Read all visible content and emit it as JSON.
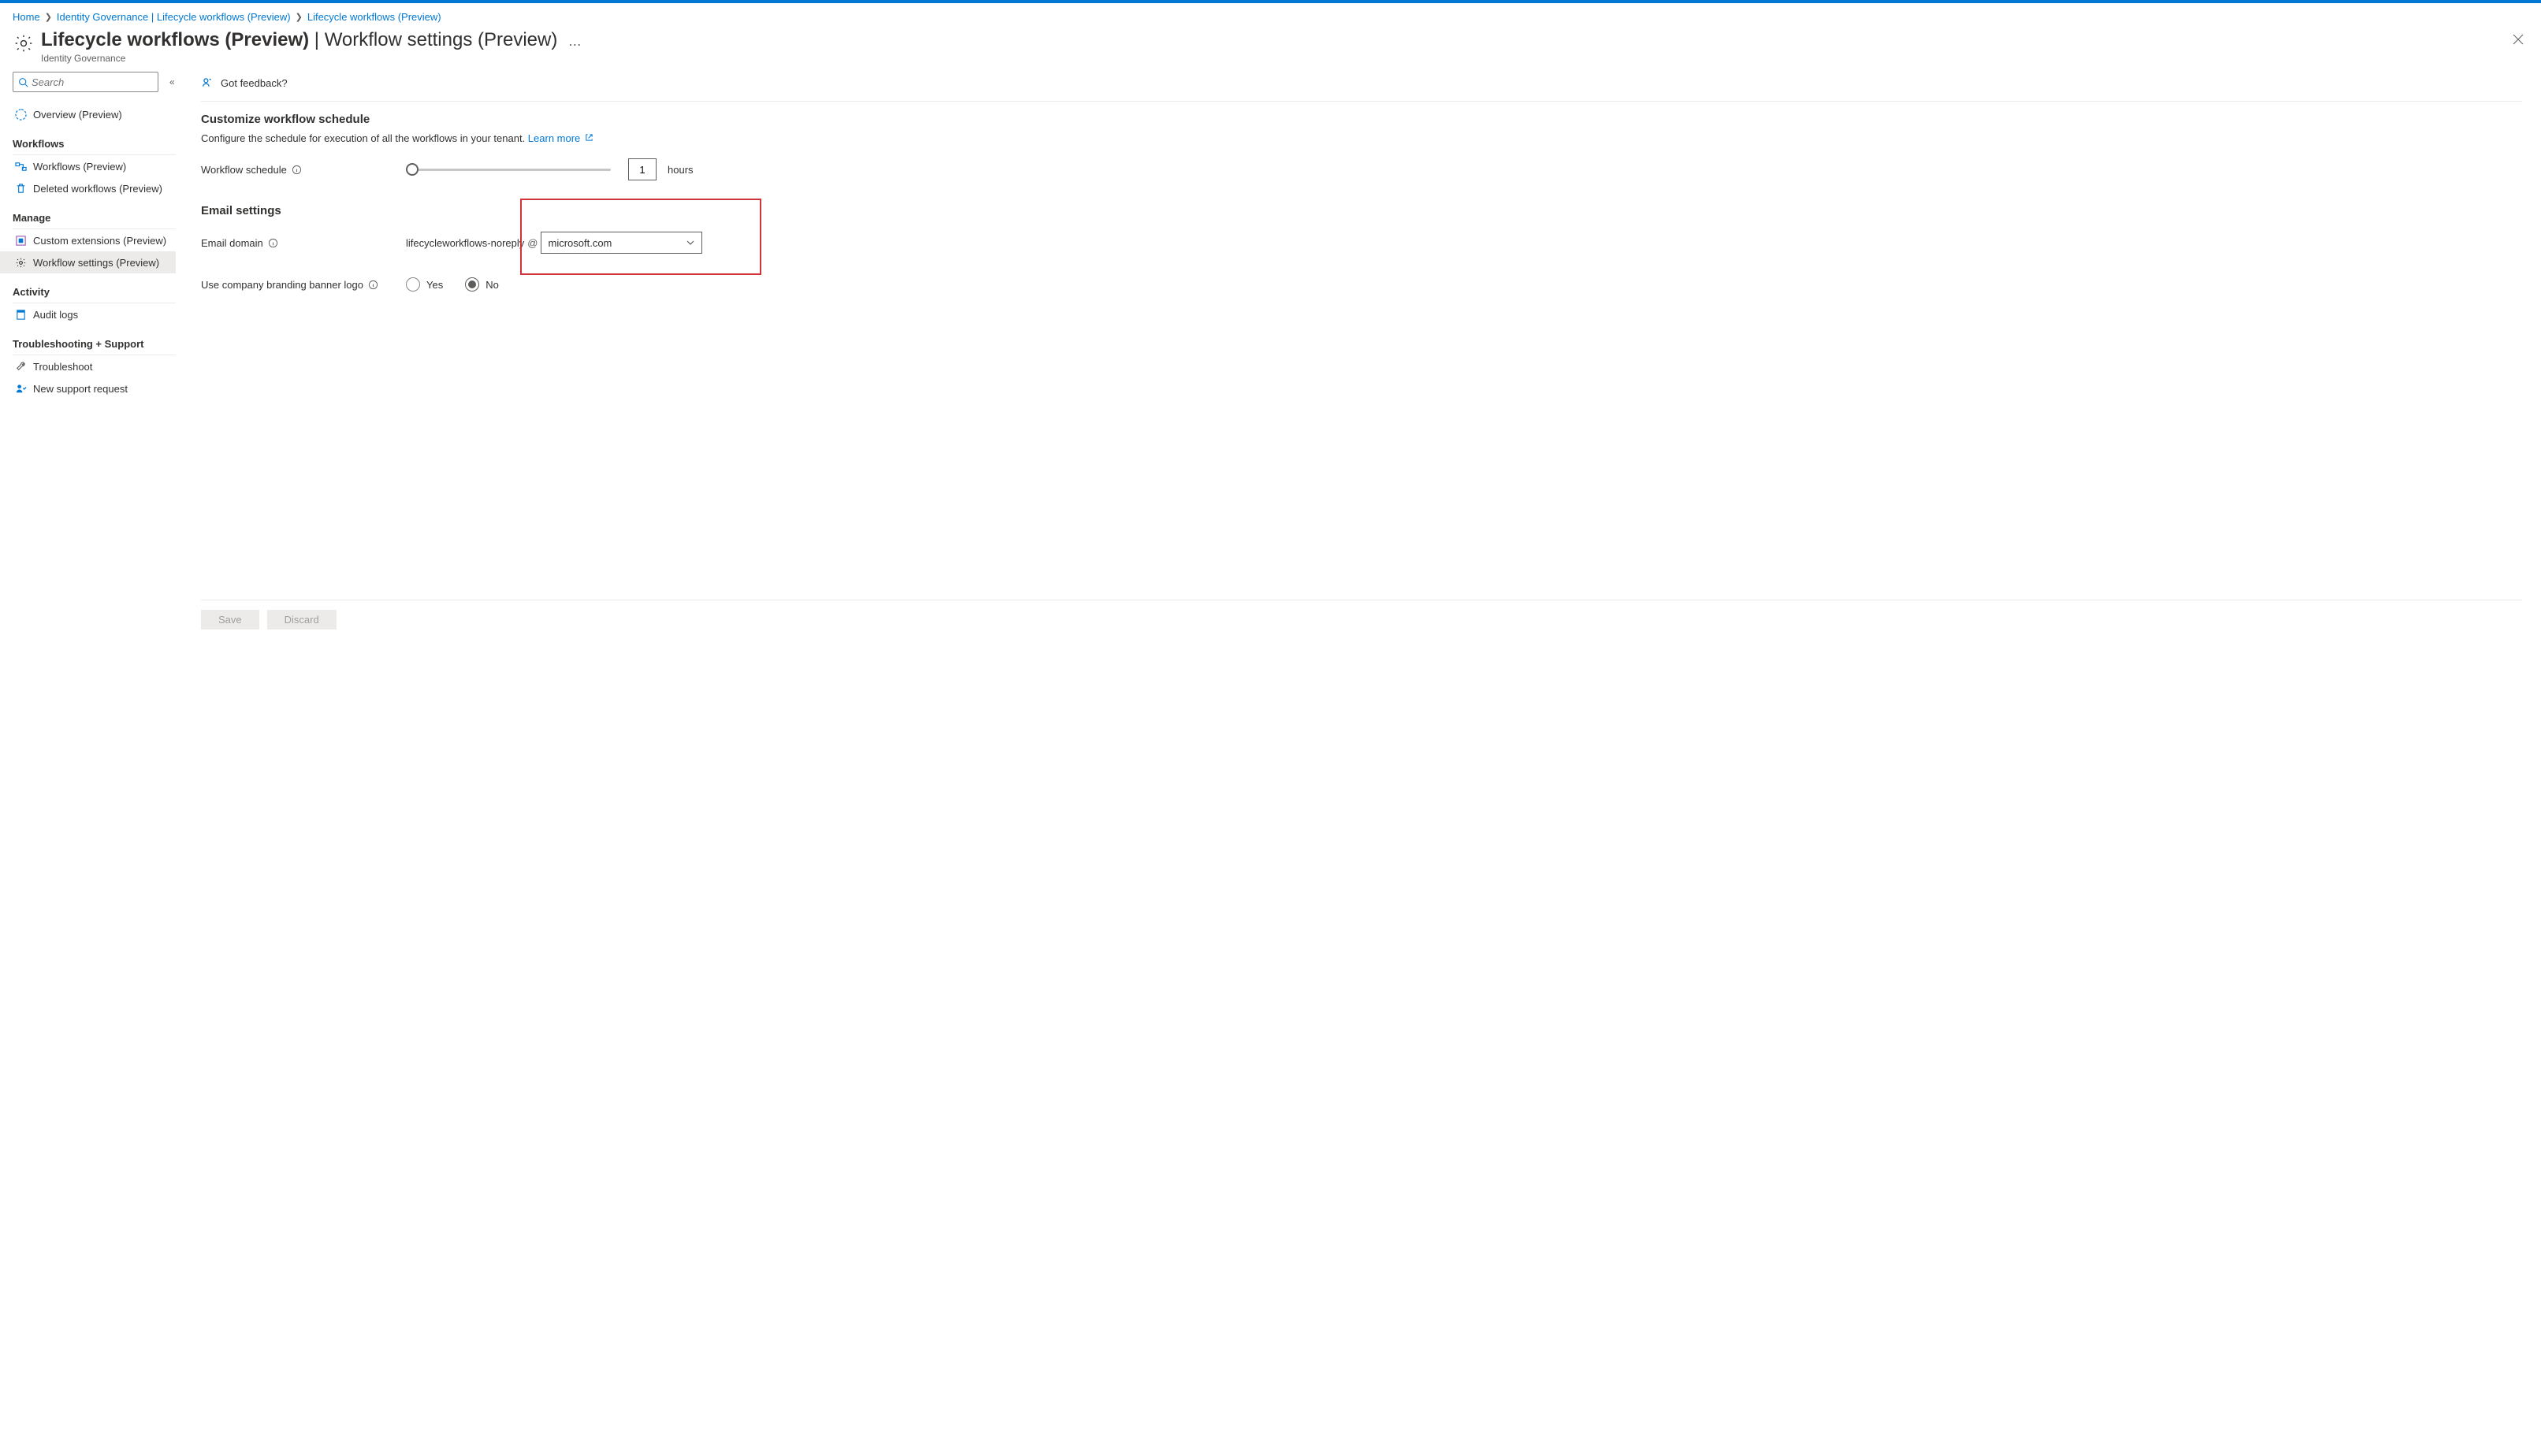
{
  "breadcrumbs": {
    "home": "Home",
    "idgov": "Identity Governance | Lifecycle workflows (Preview)",
    "lcw": "Lifecycle workflows (Preview)"
  },
  "header": {
    "title_strong": "Lifecycle workflows (Preview)",
    "title_sep": " | ",
    "title_light": "Workflow settings (Preview)",
    "subtitle": "Identity Governance"
  },
  "sidebar": {
    "search_placeholder": "Search",
    "items": {
      "overview": "Overview (Preview)",
      "group_workflows": "Workflows",
      "workflows": "Workflows (Preview)",
      "deleted": "Deleted workflows (Preview)",
      "group_manage": "Manage",
      "custom_ext": "Custom extensions (Preview)",
      "wf_settings": "Workflow settings (Preview)",
      "group_activity": "Activity",
      "audit": "Audit logs",
      "group_trouble": "Troubleshooting + Support",
      "troubleshoot": "Troubleshoot",
      "support": "New support request"
    }
  },
  "toolbar": {
    "feedback": "Got feedback?"
  },
  "schedule": {
    "title": "Customize workflow schedule",
    "desc": "Configure the schedule for execution of all the workflows in your tenant. ",
    "learn_more": "Learn more",
    "label": "Workflow schedule",
    "value": "1",
    "unit": "hours"
  },
  "email": {
    "title": "Email settings",
    "domain_label": "Email domain",
    "prefix": "lifecycleworkflows-noreply",
    "at": "@",
    "domain_value": "microsoft.com",
    "branding_label": "Use company branding banner logo",
    "yes": "Yes",
    "no": "No"
  },
  "footer": {
    "save": "Save",
    "discard": "Discard"
  }
}
